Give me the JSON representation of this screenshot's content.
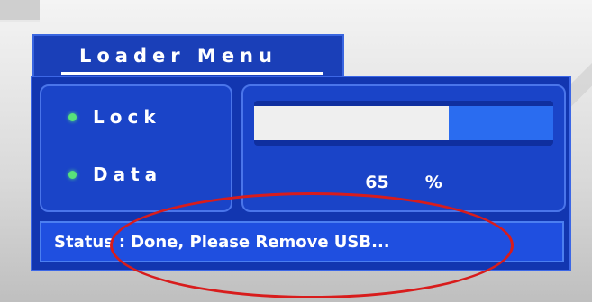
{
  "menu": {
    "title": "Loader Menu"
  },
  "indicators": [
    {
      "label": "Lock",
      "led_color": "#58e37a"
    },
    {
      "label": "Data",
      "led_color": "#58e37a"
    }
  ],
  "progress": {
    "value": 0.65,
    "percent_value": "65",
    "percent_symbol": "%"
  },
  "status": {
    "label": "Status",
    "separator": ":",
    "message": "Done, Please Remove USB..."
  },
  "colors": {
    "panel": "#1236b0",
    "accent": "#2a6cf0",
    "annotation": "#d81c1c"
  }
}
